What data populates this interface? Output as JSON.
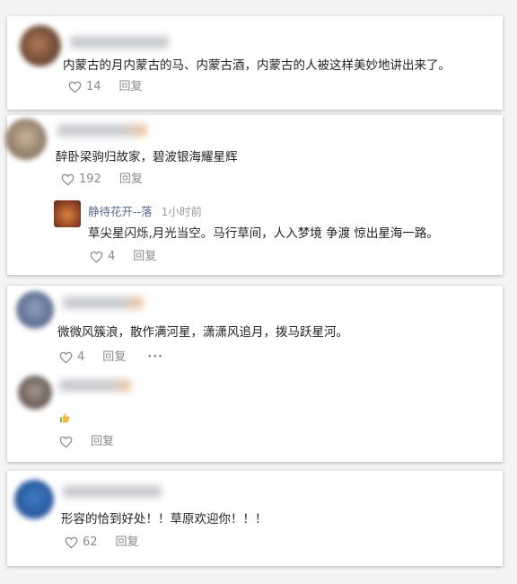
{
  "comments": [
    {
      "text": "内蒙古的月内蒙古的马、内蒙古酒，内蒙古的人被这样美妙地讲出来了。",
      "likes": "14",
      "reply_label": "回复"
    },
    {
      "text": "醉卧梁驹归故家，碧波银海耀星辉",
      "likes": "192",
      "reply_label": "回复",
      "sub_reply": {
        "author": "静待花开--落",
        "time": "1小时前",
        "text": "草尖星闪烁,月光当空。马行草间，人入梦境 争渡 惊出星海一路。",
        "likes": "4",
        "reply_label": "回复"
      }
    },
    {
      "text": "微微风簇浪，散作满河星，潇潇风追月，拨马跃星河。",
      "likes": "4",
      "reply_label": "回复",
      "more_label": "···",
      "sub_reply": {
        "emoji": "thumbs-up-icon",
        "reply_label": "回复"
      }
    },
    {
      "text": "形容的恰到好处！！草原欢迎你！！！",
      "likes": "62",
      "reply_label": "回复"
    }
  ],
  "colors": {
    "link": "#576b95",
    "muted": "#8a8a8a",
    "text": "#222222"
  }
}
